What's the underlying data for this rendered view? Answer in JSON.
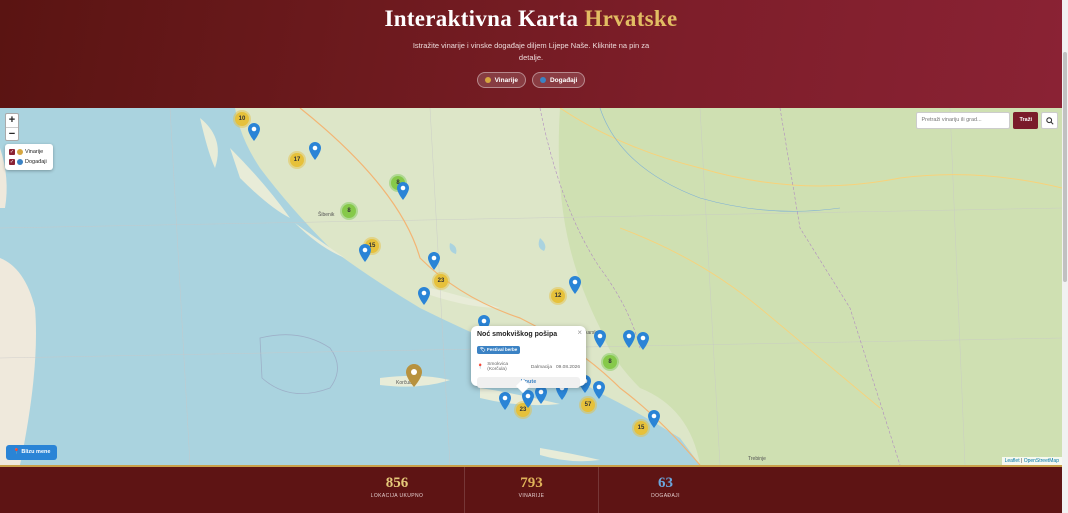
{
  "hero": {
    "title_main": "Interaktivna Karta",
    "title_accent": "Hrvatske",
    "subtitle": "Istražite vinarije i vinske događaje diljem Lijepe Naše. Kliknite na pin za detalje.",
    "filter_wineries": "Vinarije",
    "filter_events": "Događaji"
  },
  "map": {
    "zoom_in": "+",
    "zoom_out": "−",
    "layers": {
      "wineries": "Vinarije",
      "events": "Događaji"
    },
    "search": {
      "placeholder": "Pretraži vinariju ili grad...",
      "button": "Traži"
    },
    "clusters": [
      {
        "label": "10",
        "color": "gold"
      },
      {
        "label": "17",
        "color": "gold"
      },
      {
        "label": "8",
        "color": "green"
      },
      {
        "label": "8",
        "color": "green"
      },
      {
        "label": "15",
        "color": "gold"
      },
      {
        "label": "23",
        "color": "gold"
      },
      {
        "label": "12",
        "color": "gold"
      },
      {
        "label": "8",
        "color": "green"
      },
      {
        "label": "23",
        "color": "gold"
      },
      {
        "label": "57",
        "color": "gold"
      },
      {
        "label": "15",
        "color": "gold"
      }
    ],
    "popup": {
      "title": "Noć smokviškog pošipa",
      "badge": "Festival berbe",
      "location": "Smokvica (Korčula)",
      "region": "Dalmacija",
      "date": "09.08.2026",
      "button": "Upute",
      "close": "×"
    },
    "place_labels": [
      "Korčula",
      "Šibenik",
      "Makarska",
      "Trebinje"
    ],
    "attribution": {
      "leaflet": "Leaflet",
      "sep": "|",
      "osm": "OpenStreetMap"
    },
    "near_button": "Blizu mene"
  },
  "stats": [
    {
      "value": "856",
      "label": "LOKACIJA UKUPNO",
      "color": "#e6c97a"
    },
    {
      "value": "793",
      "label": "VINARIJE",
      "color": "#e0b35a"
    },
    {
      "value": "63",
      "label": "DOGAĐAJI",
      "color": "#6ba6dc"
    }
  ],
  "colors": {
    "primary": "#7a1c2a",
    "gold": "#e6c13b",
    "event": "#2a84d6",
    "winery_pin": "#b8923e"
  }
}
